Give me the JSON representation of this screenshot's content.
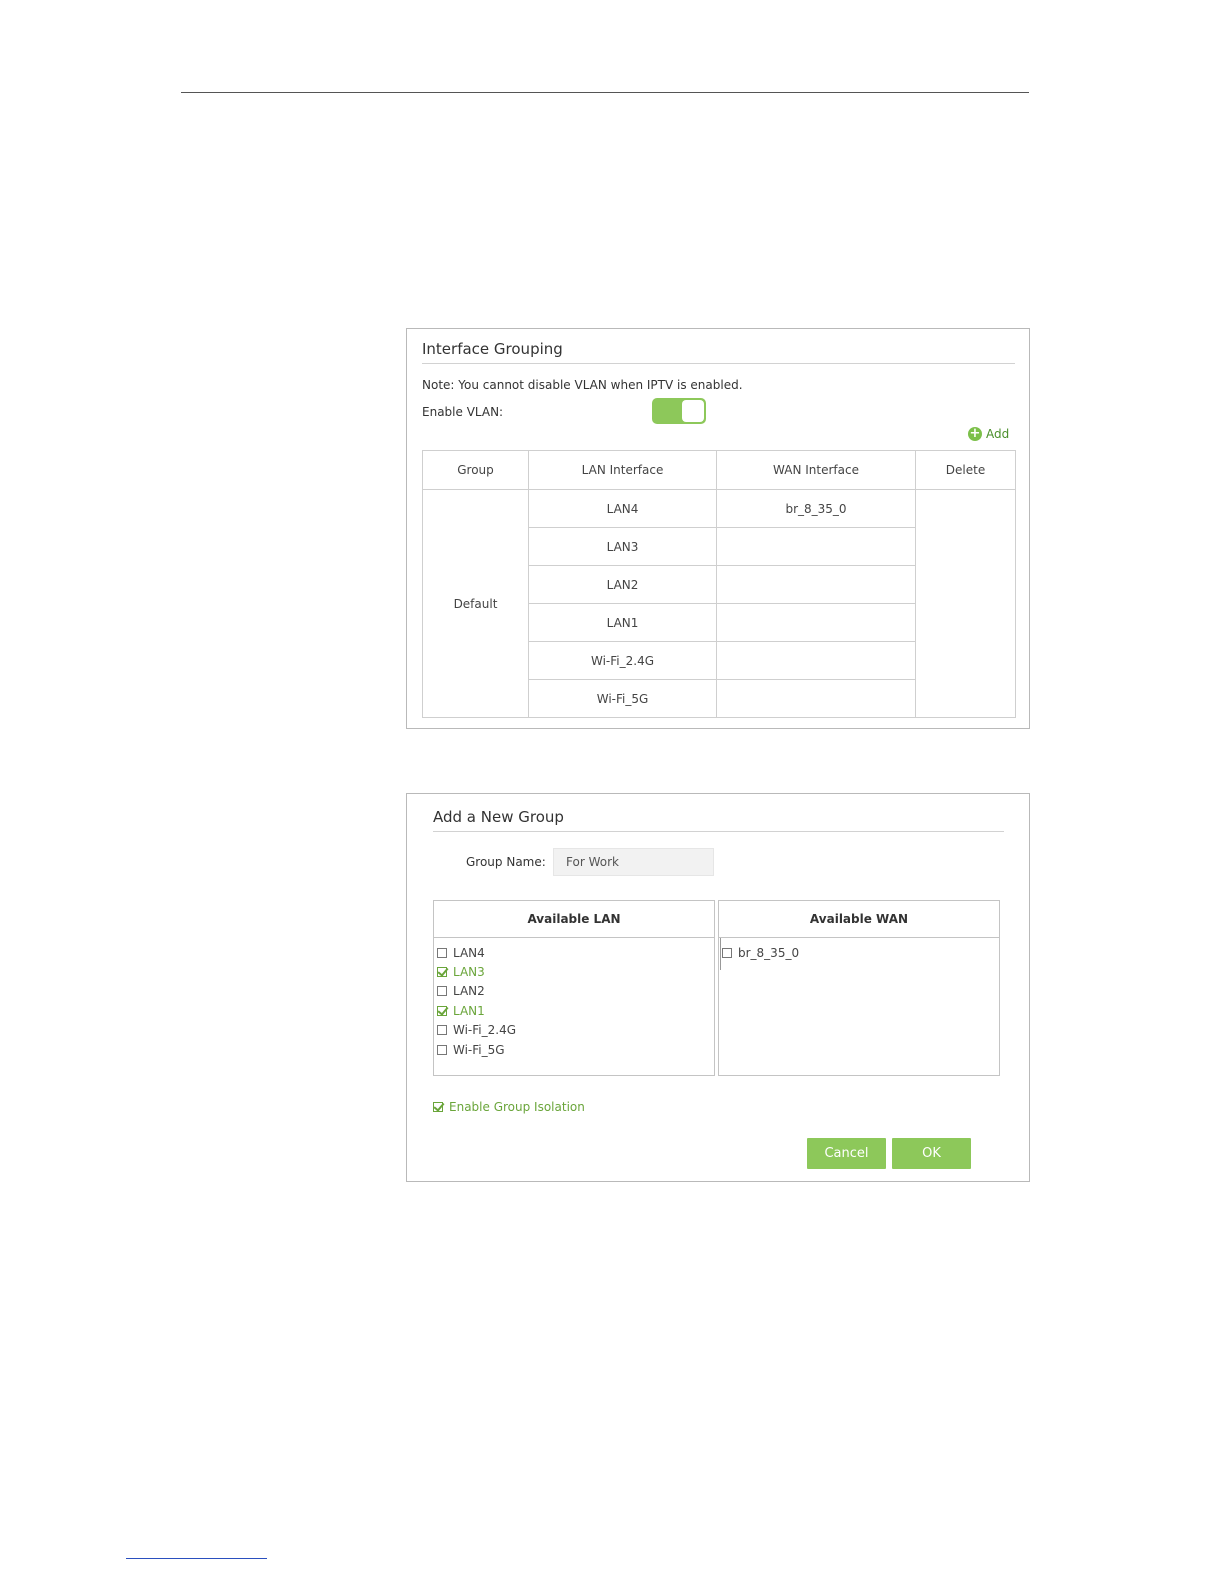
{
  "interface_grouping": {
    "title": "Interface Grouping",
    "note": "Note: You cannot disable VLAN when IPTV is enabled.",
    "enable_vlan_label": "Enable VLAN:",
    "enable_vlan_on": true,
    "add_label": "Add",
    "columns": [
      "Group",
      "LAN Interface",
      "WAN Interface",
      "Delete"
    ],
    "group_name": "Default",
    "rows": [
      {
        "lan": "LAN4",
        "wan": "br_8_35_0"
      },
      {
        "lan": "LAN3",
        "wan": ""
      },
      {
        "lan": "LAN2",
        "wan": ""
      },
      {
        "lan": "LAN1",
        "wan": ""
      },
      {
        "lan": "Wi-Fi_2.4G",
        "wan": ""
      },
      {
        "lan": "Wi-Fi_5G",
        "wan": ""
      }
    ]
  },
  "new_group": {
    "title": "Add a New Group",
    "group_name_label": "Group Name:",
    "group_name_value": "For Work",
    "available_lan_header": "Available LAN",
    "available_wan_header": "Available WAN",
    "lan_options": [
      {
        "label": "LAN4",
        "checked": false
      },
      {
        "label": "LAN3",
        "checked": true
      },
      {
        "label": "LAN2",
        "checked": false
      },
      {
        "label": "LAN1",
        "checked": true
      },
      {
        "label": "Wi-Fi_2.4G",
        "checked": false
      },
      {
        "label": "Wi-Fi_5G",
        "checked": false
      }
    ],
    "wan_options": [
      {
        "label": "br_8_35_0",
        "checked": false
      }
    ],
    "isolation_label": "Enable Group Isolation",
    "isolation_checked": true,
    "cancel_label": "Cancel",
    "ok_label": "OK"
  },
  "colors": {
    "accent_green": "#8dc85a",
    "checked_text": "#6aa53a"
  }
}
